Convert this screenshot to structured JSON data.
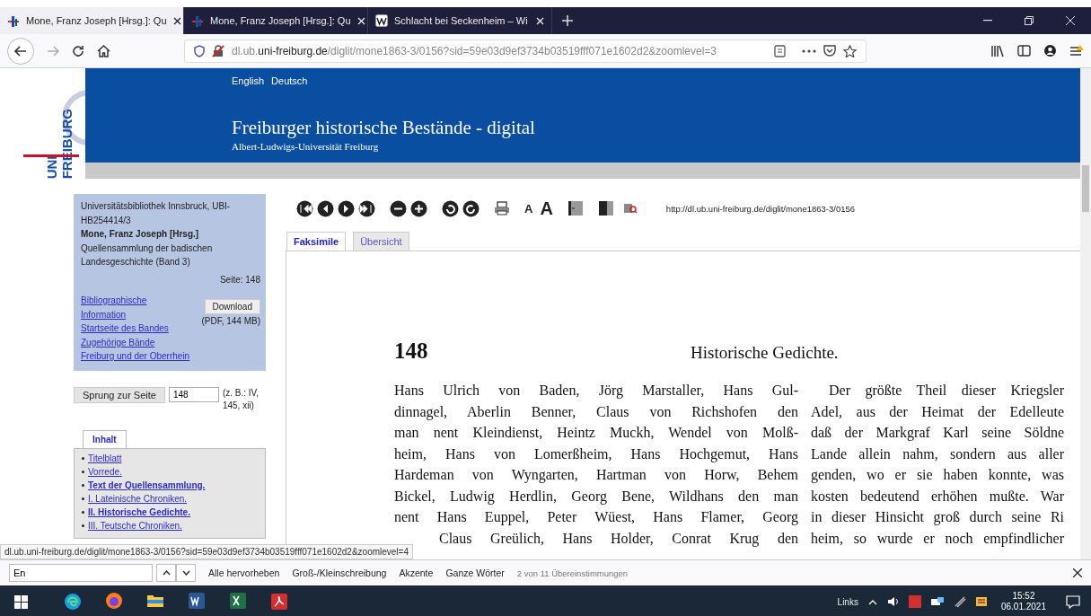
{
  "browser": {
    "tabs": [
      {
        "title": "Mone, Franz Joseph [Hrsg.]: Qu",
        "selected": true,
        "kind": "library"
      },
      {
        "title": "Mone, Franz Joseph [Hrsg.]: Qu",
        "selected": false,
        "kind": "library"
      },
      {
        "title": "Schlacht bei Seckenheim – Wi",
        "selected": false,
        "kind": "wiki"
      }
    ],
    "address": "dl.ub.**uni-freiburg.de**/diglit/mone1863-3/0156?sid=59e03d9ef3734b03519fff071e1602d2&zoomlevel=3"
  },
  "site_header": {
    "languages": [
      "English",
      "Deutsch"
    ],
    "logo_lines": [
      "UNI",
      "FREIBURG"
    ],
    "title": "Freiburger historische Bestände - digital",
    "subtitle": "Albert-Ludwigs-Universität Freiburg"
  },
  "sidebar": {
    "info_lines": [
      "Universitätsbibliothek Innsbruck, UBI-HB254414/3"
    ],
    "author": "Mone, Franz Joseph [Hrsg.]",
    "work": "Quellensammlung der badischen Landesgeschichte (Band 3)",
    "page": "Seite: 148",
    "links": [
      "Bibliographische Information",
      "Startseite des Bandes",
      "Zugehörige Bände",
      "Freiburg und der Oberrhein"
    ],
    "download_button": "Download",
    "download_note": "(PDF, 144 MB)",
    "jump_button": "Sprung zur Seite",
    "jump_value": "148",
    "jump_hint": "(z. B.: IV, 145, xii)",
    "contents_tab": {
      "label": "Inhalt",
      "selected": true
    },
    "contents": [
      {
        "label": "Titelblatt",
        "bold": false
      },
      {
        "label": "Vorrede.",
        "bold": false
      },
      {
        "label": "Text der Quellensammlung.",
        "bold": true
      },
      {
        "label": "I. Lateinische Chroniken.",
        "bold": false
      },
      {
        "label": "II. Historische Gedichte.",
        "bold": true
      },
      {
        "label": "III. Teutsche Chroniken.",
        "bold": false
      }
    ]
  },
  "viewer": {
    "font_small": "A",
    "font_large": "A",
    "permalink": "http://dl.ub.uni-freiburg.de/diglit/mone1863-3/0156",
    "tabs": [
      {
        "label": "Faksimile",
        "selected": true
      },
      {
        "label": "Übersicht",
        "selected": false
      }
    ],
    "page_number": "148",
    "running_head": "Historische Gedichte.",
    "left_column": [
      "Hans Ulrich von Baden, Jörg Marstaller, Hans Gul-",
      "dinnagel, Aberlin Benner, Claus von Richshofen den",
      "man nent Kleindienst, Heintz Muckh, Wendel von Molß-",
      "heim, Hans von Lomerßheim, Hans Hochgemut, Hans",
      "Hardeman von Wyngarten, Hartman von Horw, Behem",
      "Bickel, Ludwig Herdlin, Georg Bene, Wildhans den man",
      "nent Hans Euppel, Peter Wüest, Hans Flamer, Georg",
      "Claus Greülich, Hans Holder, Conrat Krug den"
    ],
    "right_column": [
      "Der größte Theil dieser Kriegsler",
      "Adel, aus der Heimat der Edelleute",
      "daß der Markgraf Karl seine Söldne",
      "Lande allein nahm, sondern aus aller",
      "genden, wo er sie haben konnte, was",
      "kosten bedeutend erhöhen mußte. War",
      "in dieser Hinsicht groß durch seine Ri",
      "heim, so wurde er noch empfindlicher"
    ]
  },
  "status_url": "dl.ub.uni-freiburg.de/diglit/mone1863-3/0156?sid=59e03d9ef3734b03519fff071e1602d2&zoomlevel=4",
  "find_bar": {
    "value": "En",
    "options": [
      "Alle hervorheben",
      "Groß-/Kleinschreibung",
      "Akzente",
      "Ganze Wörter"
    ],
    "result": "2 von 11 Übereinstimmungen"
  },
  "taskbar": {
    "tray_label": "Links",
    "time": "15:52",
    "date": "06.01.2021"
  }
}
